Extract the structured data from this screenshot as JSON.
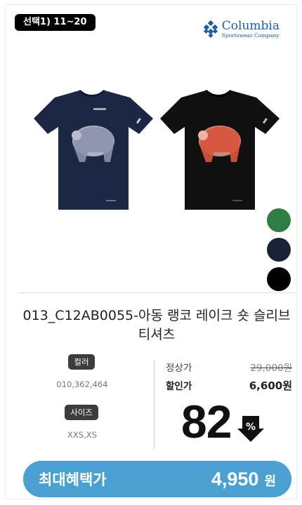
{
  "header": {
    "badge_label": "선택1) 11~20",
    "brand_name": "Columbia",
    "brand_sub": "Sportswear Company"
  },
  "product": {
    "title": "013_C12AB0055-아동 랭코 레이크 숏 슬리브 티셔츠",
    "swatch_colors": [
      "#2e7d45",
      "#1b2236",
      "#000000"
    ]
  },
  "options": {
    "color_label": "컬러",
    "color_values": "010,362,464",
    "size_label": "사이즈",
    "size_values": "XXS,XS"
  },
  "pricing": {
    "regular_label": "정상가",
    "regular_price": "29,000원",
    "sale_label": "할인가",
    "sale_price": "6,600원",
    "discount_number": "82",
    "discount_symbol": "%"
  },
  "cta": {
    "label": "최대혜택가",
    "amount": "4,950",
    "unit": "원"
  },
  "colors": {
    "accent": "#4aa0d0",
    "brand": "#1a5fa8"
  }
}
